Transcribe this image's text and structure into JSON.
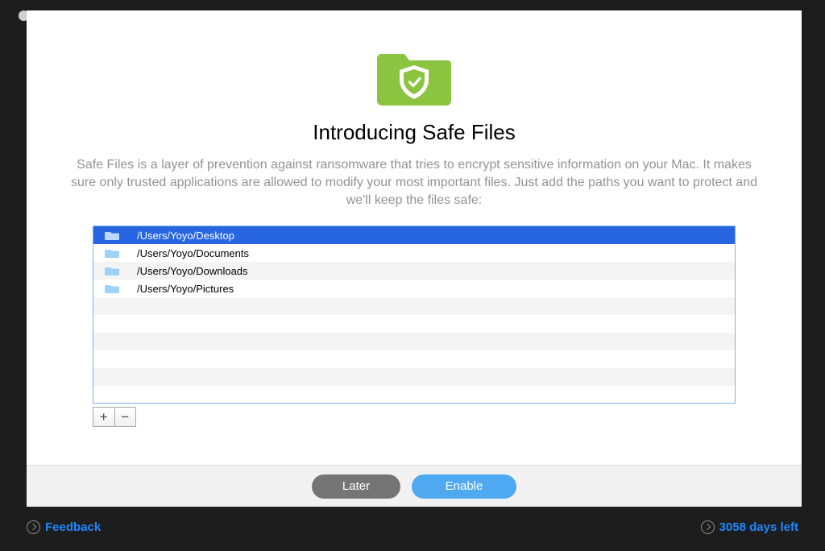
{
  "title": "Introducing Safe Files",
  "description": "Safe Files is a layer of prevention against ransomware that tries to encrypt sensitive information on your Mac. It makes sure only trusted applications are allowed to modify your most important files. Just add the paths you want to protect and we'll keep the files safe:",
  "paths": [
    {
      "path": "/Users/Yoyo/Desktop",
      "selected": true
    },
    {
      "path": "/Users/Yoyo/Documents",
      "selected": false
    },
    {
      "path": "/Users/Yoyo/Downloads",
      "selected": false
    },
    {
      "path": "/Users/Yoyo/Pictures",
      "selected": false
    }
  ],
  "empty_rows": 6,
  "buttons": {
    "add": "+",
    "remove": "−",
    "later": "Later",
    "enable": "Enable"
  },
  "footer": {
    "feedback": "Feedback",
    "days_left": "3058 days left"
  }
}
